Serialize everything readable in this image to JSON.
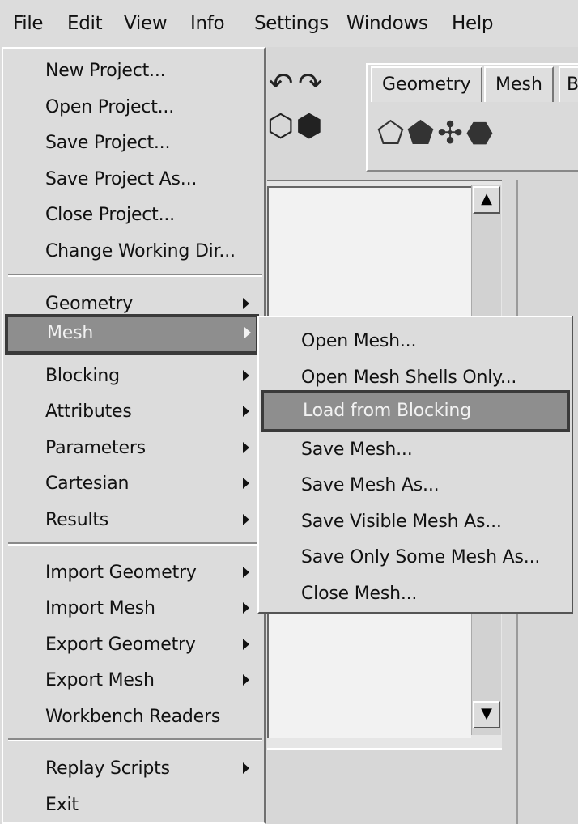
{
  "menubar": {
    "items": [
      "File",
      "Edit",
      "View",
      "Info",
      "Settings",
      "Windows",
      "Help"
    ]
  },
  "toolbar": {
    "tabs": [
      "Geometry",
      "Mesh",
      "B"
    ]
  },
  "file_menu": {
    "items": [
      {
        "label": "New Project...",
        "submenu": false
      },
      {
        "label": "Open Project...",
        "submenu": false
      },
      {
        "label": "Save Project...",
        "submenu": false
      },
      {
        "label": "Save Project As...",
        "submenu": false
      },
      {
        "label": "Close Project...",
        "submenu": false
      },
      {
        "label": "Change Working Dir...",
        "submenu": false
      },
      {
        "label": "Geometry",
        "submenu": true
      },
      {
        "label": "Mesh",
        "submenu": true,
        "highlighted": true
      },
      {
        "label": "Blocking",
        "submenu": true
      },
      {
        "label": "Attributes",
        "submenu": true
      },
      {
        "label": "Parameters",
        "submenu": true
      },
      {
        "label": "Cartesian",
        "submenu": true
      },
      {
        "label": "Results",
        "submenu": true
      },
      {
        "label": "Import Geometry",
        "submenu": true
      },
      {
        "label": "Import Mesh",
        "submenu": true
      },
      {
        "label": "Export Geometry",
        "submenu": true
      },
      {
        "label": "Export Mesh",
        "submenu": true
      },
      {
        "label": "Workbench Readers",
        "submenu": false
      },
      {
        "label": "Replay Scripts",
        "submenu": true
      },
      {
        "label": "Exit",
        "submenu": false
      }
    ]
  },
  "mesh_submenu": {
    "items": [
      {
        "label": "Open Mesh..."
      },
      {
        "label": "Open Mesh Shells Only..."
      },
      {
        "label": "Load from Blocking",
        "highlighted": true
      },
      {
        "label": "Save Mesh..."
      },
      {
        "label": "Save Mesh As..."
      },
      {
        "label": "Save Visible Mesh As..."
      },
      {
        "label": "Save Only Some Mesh As..."
      },
      {
        "label": "Close Mesh..."
      }
    ]
  },
  "colors": {
    "menu_bg": "#dcdcdc",
    "highlight_bg": "#8e8e8e",
    "highlight_border": "#3a3a3a",
    "highlight_text": "#f2f2f2"
  }
}
